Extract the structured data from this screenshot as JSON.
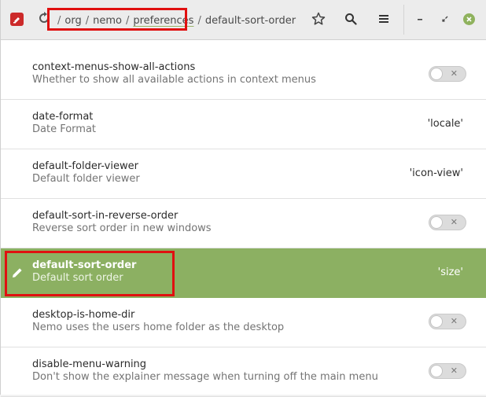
{
  "header": {
    "path_segments": [
      "org",
      "nemo",
      "preferences"
    ],
    "current_key": "default-sort-order"
  },
  "rows": [
    {
      "key": "context-menus-show-all-actions",
      "desc": "Whether to show all available actions in context menus",
      "kind": "toggle"
    },
    {
      "key": "date-format",
      "desc": "Date Format",
      "kind": "value",
      "value": "'locale'"
    },
    {
      "key": "default-folder-viewer",
      "desc": "Default folder viewer",
      "kind": "value",
      "value": "'icon-view'"
    },
    {
      "key": "default-sort-in-reverse-order",
      "desc": "Reverse sort order in new windows",
      "kind": "toggle"
    },
    {
      "key": "default-sort-order",
      "desc": "Default sort order",
      "kind": "value",
      "value": "'size'",
      "selected": true
    },
    {
      "key": "desktop-is-home-dir",
      "desc": "Nemo uses the users home folder as the desktop",
      "kind": "toggle"
    },
    {
      "key": "disable-menu-warning",
      "desc": "Don't show the explainer message when turning off the main menu",
      "kind": "toggle"
    }
  ],
  "colors": {
    "accent": "#8cb062",
    "annotation": "#e01010"
  }
}
